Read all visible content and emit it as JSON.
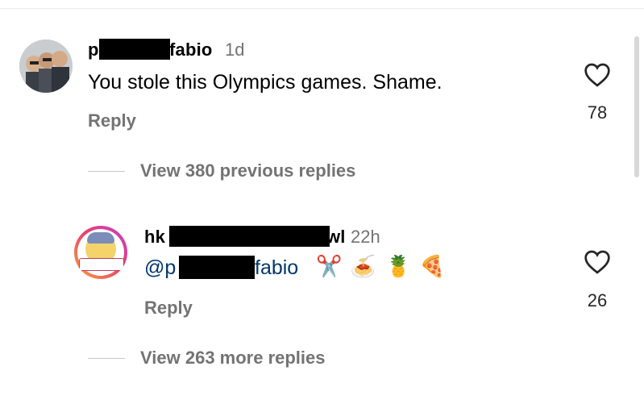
{
  "comment": {
    "username_start": "p",
    "username_end": "fabio",
    "time": "1d",
    "text": "You stole this Olympics games. Shame.",
    "reply_label": "Reply",
    "likes": "78"
  },
  "view_previous": "View 380 previous replies",
  "reply": {
    "username_start": "hk",
    "username_end": "wl",
    "time": "22h",
    "mention_start": "@p",
    "mention_end": "fabio",
    "emojis": [
      "✂️",
      "🍝",
      "🍍",
      "🍕"
    ],
    "reply_label": "Reply",
    "likes": "26"
  },
  "view_more": "View 263 more replies",
  "colors": {
    "muted": "#737373",
    "mention": "#00376b",
    "divider": "#c7c7c7"
  },
  "icons": [
    "avatar-photo",
    "avatar-cartoon",
    "heart-outline-icon"
  ]
}
